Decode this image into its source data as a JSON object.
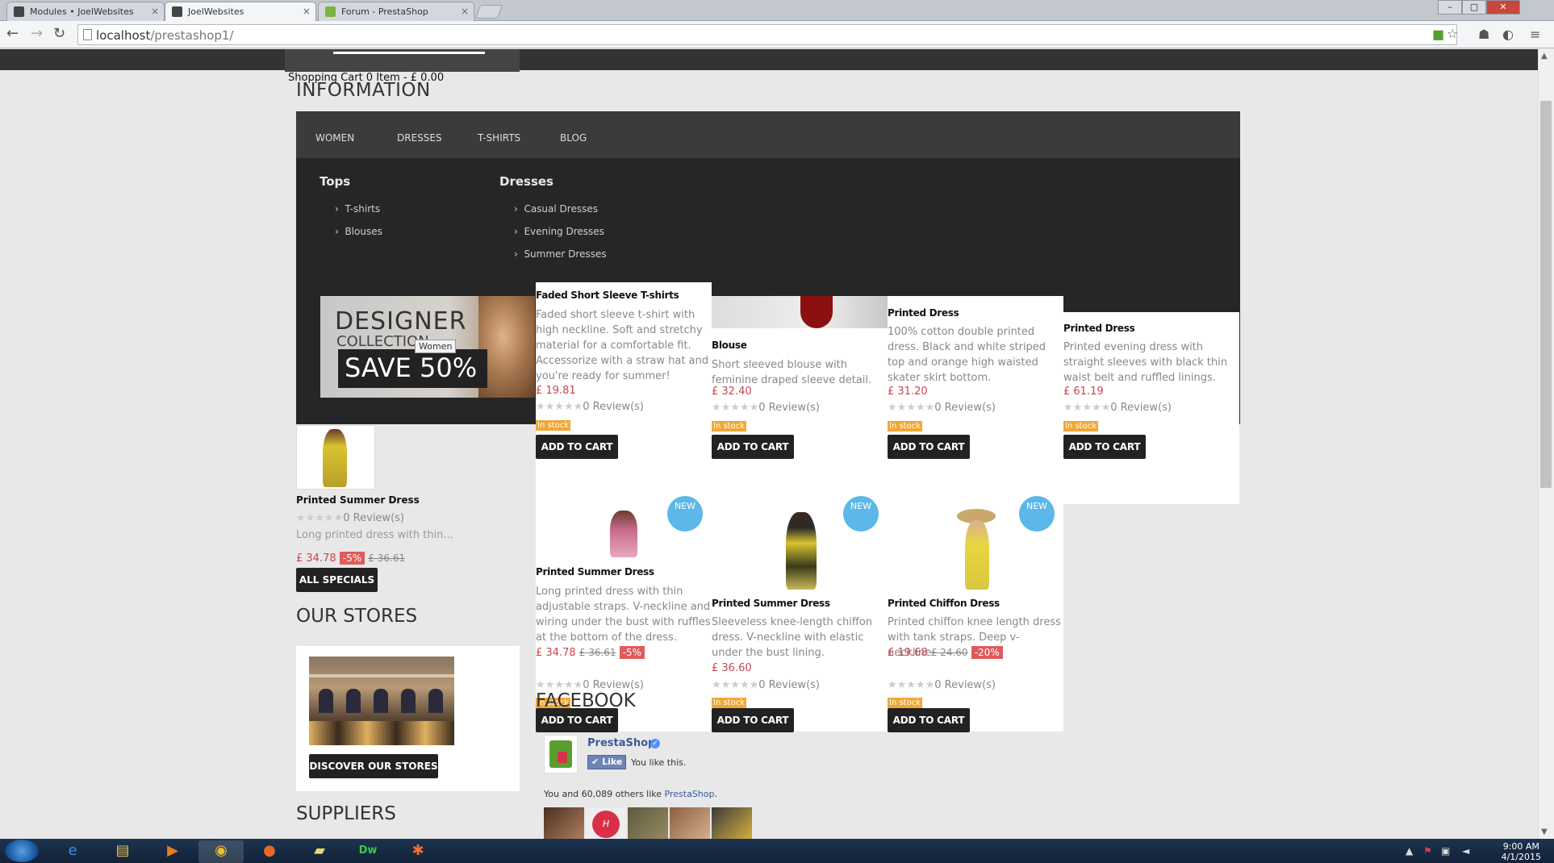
{
  "browser": {
    "tabs": [
      {
        "label": "Modules • JoelWebsites"
      },
      {
        "label": "JoelWebsites"
      },
      {
        "label": "Forum - PrestaShop"
      }
    ],
    "url_host": "localhost",
    "url_path": "/prestashop1/"
  },
  "header": {
    "cart": "Shopping Cart 0 Item - £ 0.00",
    "info_title": "INFORMATION"
  },
  "menu": {
    "items": [
      "WOMEN",
      "DRESSES",
      "T-SHIRTS",
      "BLOG"
    ],
    "dropdown": {
      "tops_title": "Tops",
      "tops": [
        "T-shirts",
        "Blouses"
      ],
      "dresses_title": "Dresses",
      "dresses": [
        "Casual Dresses",
        "Evening Dresses",
        "Summer Dresses"
      ]
    },
    "banner": {
      "line1": "DESIGNER",
      "line2": "COLLECTION",
      "line3": "SAVE 50%"
    },
    "tooltip": "Women"
  },
  "products": [
    {
      "name": "Faded Short Sleeve T-shirts",
      "desc": "Faded short sleeve t-shirt with high neckline. Soft and stretchy material for a comfortable fit. Accessorize with a straw hat and you're ready for summer!",
      "price": "£ 19.81",
      "reviews": "0 Review(s)",
      "stock": "In stock",
      "button": "ADD TO CART"
    },
    {
      "name": "Blouse",
      "desc": "Short sleeved blouse with feminine draped sleeve detail.",
      "price": "£ 32.40",
      "reviews": "0 Review(s)",
      "stock": "In stock",
      "button": "ADD TO CART"
    },
    {
      "name": "Printed Dress",
      "desc": "100% cotton double printed dress. Black and white striped top and orange high waisted skater skirt bottom.",
      "price": "£ 31.20",
      "reviews": "0 Review(s)",
      "stock": "In stock",
      "button": "ADD TO CART"
    },
    {
      "name": "Printed Dress",
      "desc": "Printed evening dress with straight sleeves with black thin waist belt and ruffled linings.",
      "price": "£ 61.19",
      "reviews": "0 Review(s)",
      "stock": "In stock",
      "button": "ADD TO CART"
    },
    {
      "name": "Printed Summer Dress",
      "desc": "Long printed dress with thin adjustable straps. V-neckline and wiring under the bust with ruffles at the bottom of the dress.",
      "price": "£ 34.78",
      "old_price": "£ 36.61",
      "discount": "-5%",
      "reviews": "0 Review(s)",
      "stock": "In stock",
      "button": "ADD TO CART",
      "badge": "NEW"
    },
    {
      "name": "Printed Summer Dress",
      "desc": "Sleeveless knee-length chiffon dress. V-neckline with elastic under the bust lining.",
      "price": "£ 36.60",
      "reviews": "0 Review(s)",
      "stock": "In stock",
      "button": "ADD TO CART",
      "badge": "NEW"
    },
    {
      "name": "Printed Chiffon Dress",
      "desc": "Printed chiffon knee length dress with tank straps. Deep v-neckline.",
      "price": "£ 19.68",
      "old_price": "£ 24.60",
      "discount": "-20%",
      "reviews": "0 Review(s)",
      "stock": "In stock",
      "button": "ADD TO CART",
      "badge": "NEW"
    }
  ],
  "specials": {
    "name": "Printed Summer Dress",
    "reviews": "0 Review(s)",
    "desc": "Long printed dress with thin...",
    "price": "£ 34.78",
    "discount": "-5%",
    "old_price": "£ 36.61",
    "button": "ALL SPECIALS"
  },
  "stores": {
    "title": "OUR STORES",
    "button": "DISCOVER OUR STORES"
  },
  "suppliers": {
    "title": "SUPPLIERS"
  },
  "facebook": {
    "title": "FACEBOOK",
    "page_name": "PrestaShop",
    "like_button": "Like",
    "you_like": "You like this.",
    "others_prefix": "You and 60,089 others like ",
    "others_link": "PrestaShop",
    "others_suffix": "."
  },
  "taskbar": {
    "time": "9:00 AM",
    "date": "4/1/2015"
  },
  "colors": {
    "accent_blue": "#5bb8e8",
    "price_red": "#c8464c",
    "stock_orange": "#f0a836",
    "menu_dark": "#262626"
  }
}
